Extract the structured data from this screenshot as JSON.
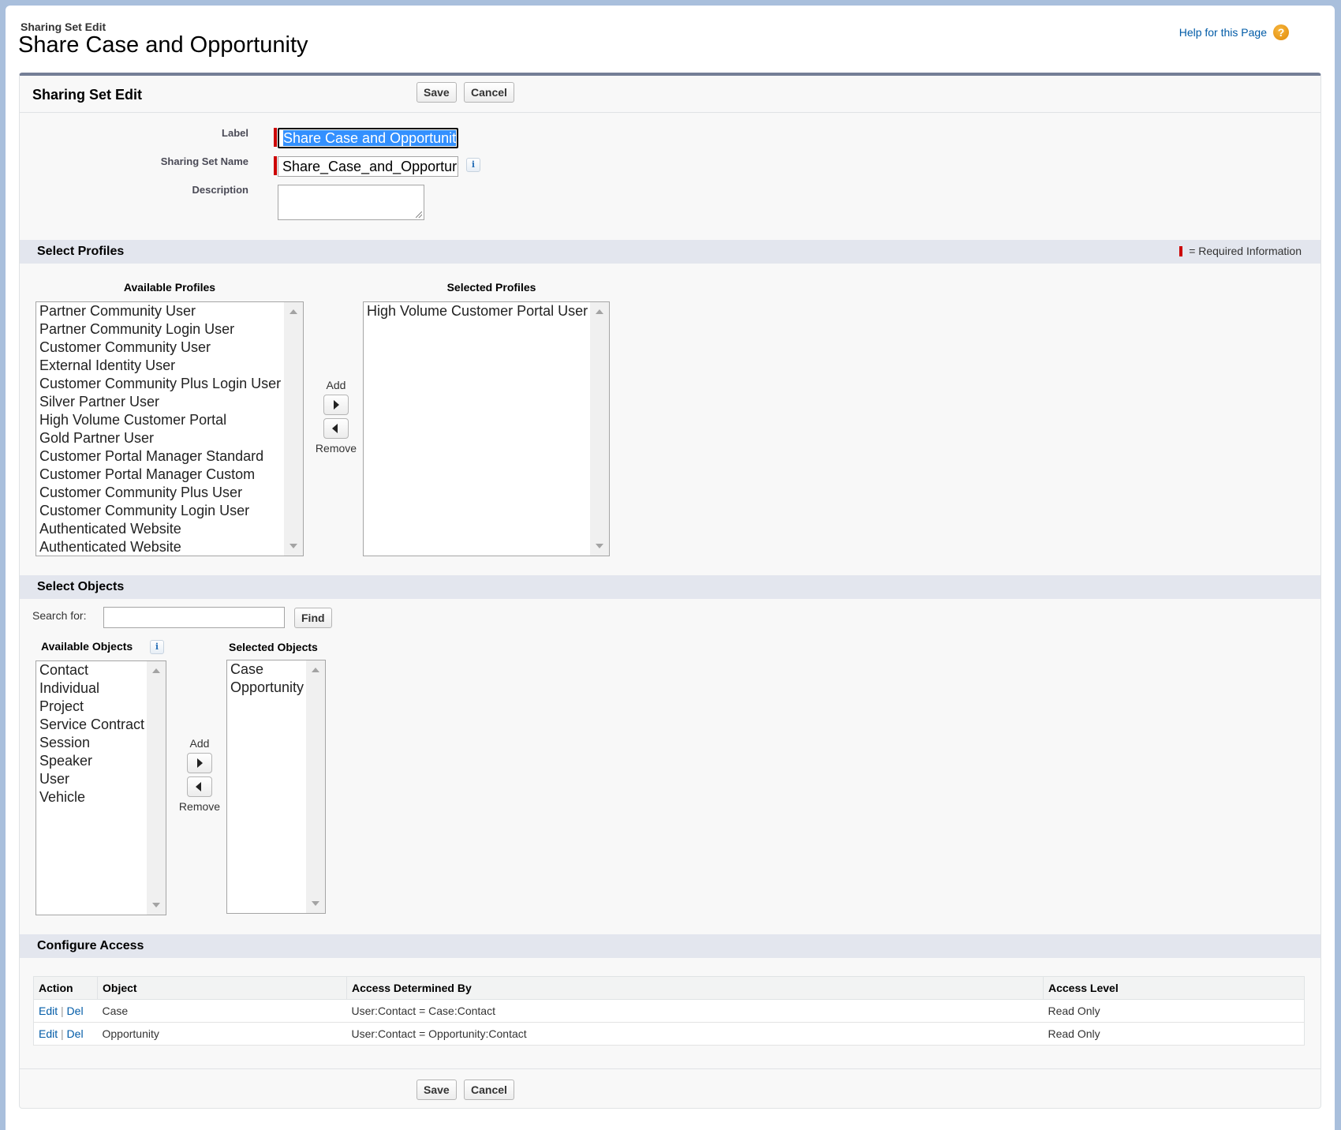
{
  "header": {
    "pretitle": "Sharing Set Edit",
    "title": "Share Case and Opportunity",
    "help_link": "Help for this Page",
    "help_icon": "question-circle-icon"
  },
  "panel": {
    "title": "Sharing Set Edit",
    "save_label": "Save",
    "cancel_label": "Cancel"
  },
  "fields": {
    "label": {
      "label": "Label",
      "value": "Share Case and Opportunit"
    },
    "sharing_set_name": {
      "label": "Sharing Set Name",
      "value": "Share_Case_and_Opportur"
    },
    "description": {
      "label": "Description",
      "value": ""
    }
  },
  "colors": {
    "required": "#cc0000",
    "link": "#015ba7",
    "section_bar": "#e3e6ee",
    "panel_top_border": "#747e96",
    "selection": "#3390ff"
  },
  "profiles": {
    "section_title": "Select Profiles",
    "required_legend": "= Required Information",
    "available_label": "Available Profiles",
    "selected_label": "Selected Profiles",
    "add_label": "Add",
    "remove_label": "Remove",
    "available": [
      "Partner Community User",
      "Partner Community Login User",
      "Customer Community User",
      "External Identity User",
      "Customer Community Plus Login User",
      "Silver Partner User",
      "High Volume Customer Portal",
      "Gold Partner User",
      "Customer Portal Manager Standard",
      "Customer Portal Manager Custom",
      "Customer Community Plus User",
      "Customer Community Login User",
      "Authenticated Website",
      "Authenticated Website"
    ],
    "selected": [
      "High Volume Customer Portal User"
    ]
  },
  "objects": {
    "section_title": "Select Objects",
    "search_label": "Search  for:",
    "search_value": "",
    "find_label": "Find",
    "available_label": "Available Objects",
    "selected_label": "Selected Objects",
    "add_label": "Add",
    "remove_label": "Remove",
    "available": [
      "Contact",
      "Individual",
      "Project",
      "Service Contract",
      "Session",
      "Speaker",
      "User",
      "Vehicle"
    ],
    "selected": [
      "Case",
      "Opportunity"
    ]
  },
  "access": {
    "section_title": "Configure Access",
    "columns": [
      "Action",
      "Object",
      "Access Determined By",
      "Access Level"
    ],
    "edit_label": "Edit",
    "del_label": "Del",
    "separator": "|",
    "rows": [
      {
        "object": "Case",
        "determined_by": "User:Contact = Case:Contact",
        "level": "Read Only"
      },
      {
        "object": "Opportunity",
        "determined_by": "User:Contact = Opportunity:Contact",
        "level": "Read Only"
      }
    ]
  }
}
